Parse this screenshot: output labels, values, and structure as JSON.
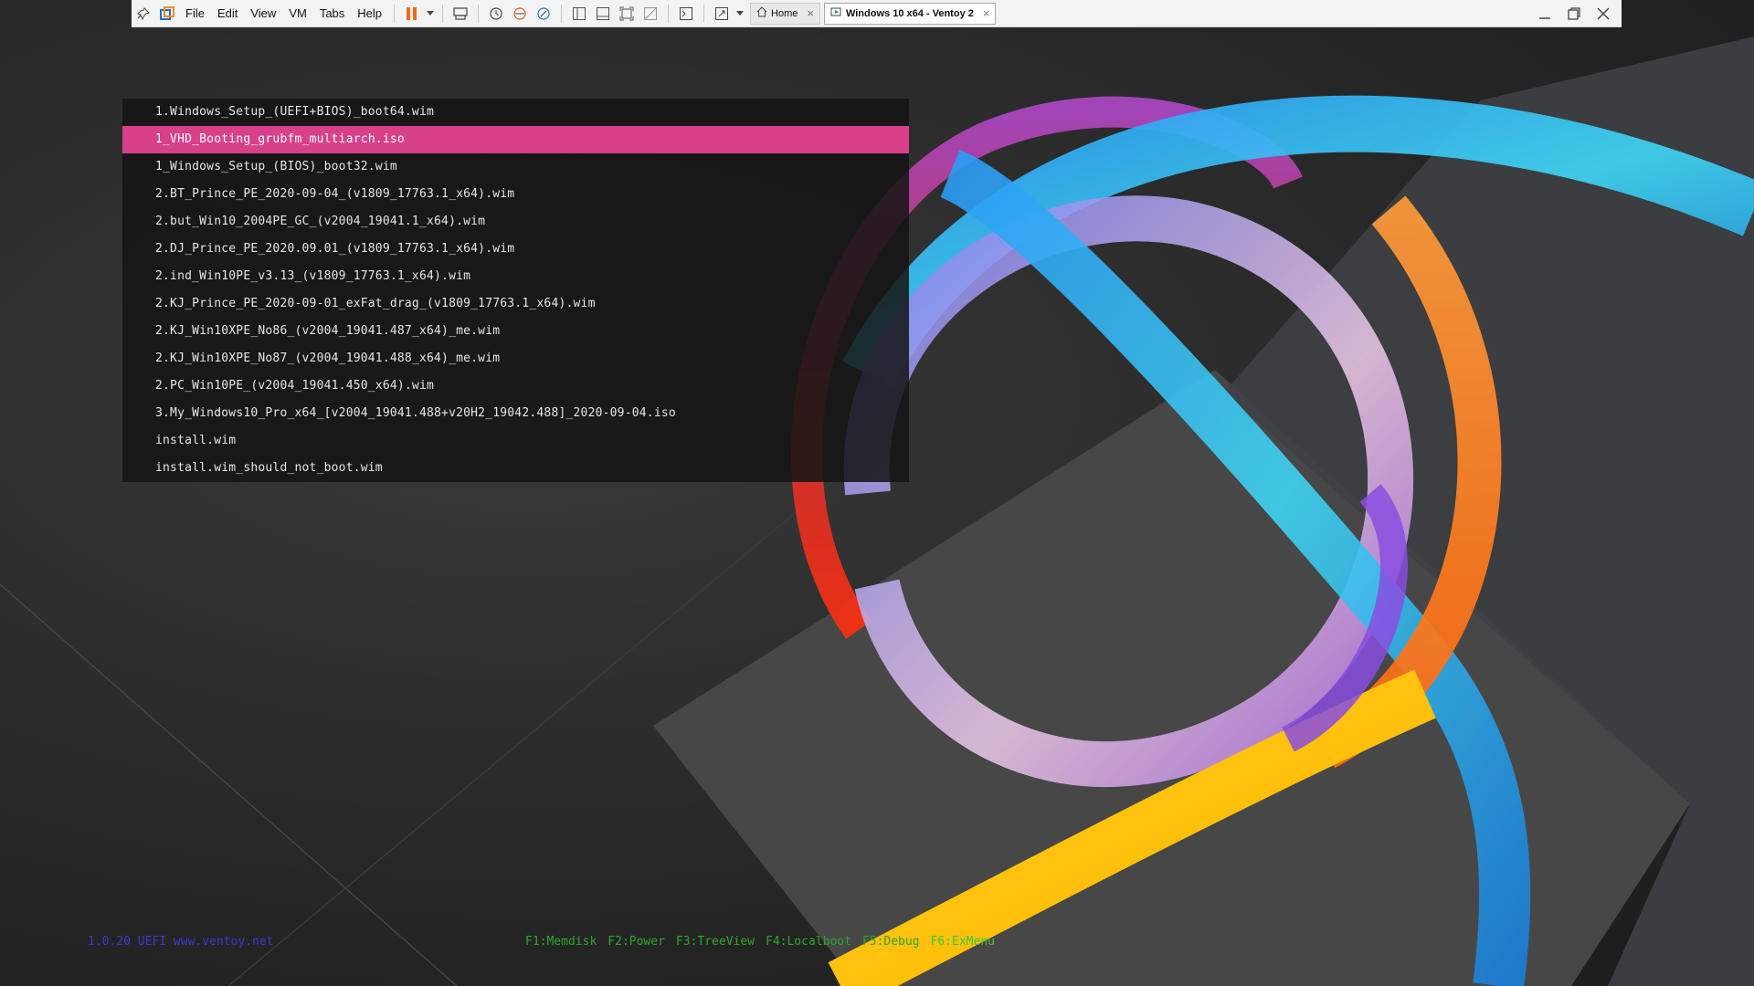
{
  "toolbar": {
    "menus": [
      "File",
      "Edit",
      "View",
      "VM",
      "Tabs",
      "Help"
    ],
    "tabs": [
      {
        "label": "Home",
        "active": false
      },
      {
        "label": "Windows 10 x64 - Ventoy 2",
        "active": true
      }
    ],
    "pause_color": "#f26a1b"
  },
  "boot_menu": {
    "selected_index": 1,
    "selected_color": "#d8418a",
    "items": [
      "1.Windows_Setup_(UEFI+BIOS)_boot64.wim",
      "1_VHD_Booting_grubfm_multiarch.iso",
      "1_Windows_Setup_(BIOS)_boot32.wim",
      "2.BT_Prince_PE_2020-09-04_(v1809_17763.1_x64).wim",
      "2.but_Win10_2004PE_GC_(v2004_19041.1_x64).wim",
      "2.DJ_Prince_PE_2020.09.01_(v1809_17763.1_x64).wim",
      "2.ind_Win10PE_v3.13_(v1809_17763.1_x64).wim",
      "2.KJ_Prince_PE_2020-09-01_exFat_drag_(v1809_17763.1_x64).wim",
      "2.KJ_Win10XPE_No86_(v2004_19041.487_x64)_me.wim",
      "2.KJ_Win10XPE_No87_(v2004_19041.488_x64)_me.wim",
      "2.PC_Win10PE_(v2004_19041.450_x64).wim",
      "3.My_Windows10_Pro_x64_[v2004_19041.488+v20H2_19042.488]_2020-09-04.iso",
      "install.wim",
      "install.wim_should_not_boot.wim"
    ]
  },
  "footer": {
    "version": "1.0.20 UEFI  www.ventoy.net",
    "keys": [
      "F1:Memdisk",
      "F2:Power",
      "F3:TreeView",
      "F4:Localboot",
      "F5:Debug",
      "F6:ExMenu"
    ]
  }
}
